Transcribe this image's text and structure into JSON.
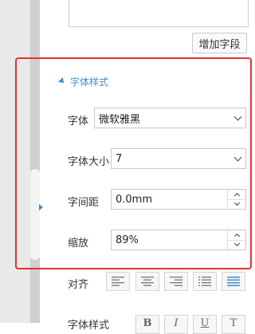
{
  "panel": {
    "add_field_label": "增加字段",
    "section_title": "字体样式",
    "font_label": "字体",
    "font_value": "微软雅黑",
    "size_label": "字体大小",
    "size_value": "7",
    "spacing_label": "字间距",
    "spacing_value": "0.0mm",
    "scale_label": "缩放",
    "scale_value": "89%",
    "align_label": "对齐",
    "align_buttons": [
      "align-left",
      "align-center",
      "align-right",
      "align-list",
      "align-justify"
    ],
    "style_label": "字体样式",
    "style_buttons": [
      "B",
      "I",
      "U",
      "T"
    ]
  },
  "colors": {
    "accent": "#3d8fd1",
    "highlight_border": "#e5322d"
  }
}
